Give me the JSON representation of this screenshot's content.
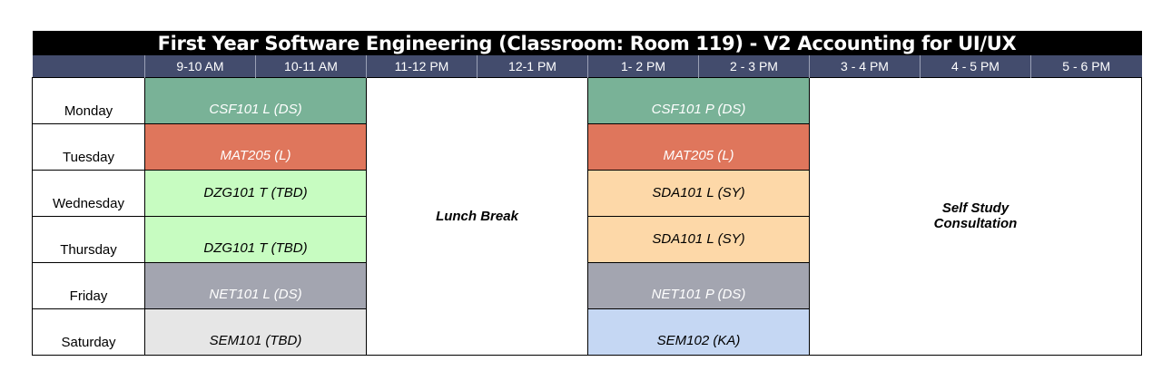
{
  "title": "First Year Software Engineering (Classroom: Room 119) - V2 Accounting for UI/UX",
  "time_slots": [
    "9-10 AM",
    "10-11 AM",
    "11-12 PM",
    "12-1 PM",
    "1- 2 PM",
    "2 - 3 PM",
    "3 - 4 PM",
    "4 - 5 PM",
    "5 - 6 PM"
  ],
  "days": [
    "Monday",
    "Tuesday",
    "Wednesday",
    "Thursday",
    "Friday",
    "Saturday"
  ],
  "morning": [
    {
      "label": "CSF101 L (DS)",
      "color": "#79b297"
    },
    {
      "label": "MAT205 (L)",
      "color": "#df765c"
    },
    {
      "label": "DZG101 T (TBD)",
      "color": "#c7fcc1"
    },
    {
      "label": "DZG101 T (TBD)",
      "color": "#c7fcc1"
    },
    {
      "label": "NET101 L (DS)",
      "color": "#a3a5b0"
    },
    {
      "label": "SEM101 (TBD)",
      "color": "#e6e6e6"
    }
  ],
  "afternoon": [
    {
      "label": "CSF101 P (DS)",
      "color": "#79b297"
    },
    {
      "label": "MAT205 (L)",
      "color": "#df765c"
    },
    {
      "label": "SDA101 L (SY)",
      "color": "#fdd8a8"
    },
    {
      "label": "SDA101 L (SY)",
      "color": "#fdd8a8"
    },
    {
      "label": "NET101 P (DS)",
      "color": "#a3a5b0"
    },
    {
      "label": "SEM102 (KA)",
      "color": "#c5d7f3"
    }
  ],
  "lunch_label": "Lunch Break",
  "self_study": {
    "line1": "Self Study",
    "line2": "Consultation"
  },
  "colors": {
    "header_bg": "#434c6d",
    "title_bg": "#000000"
  }
}
